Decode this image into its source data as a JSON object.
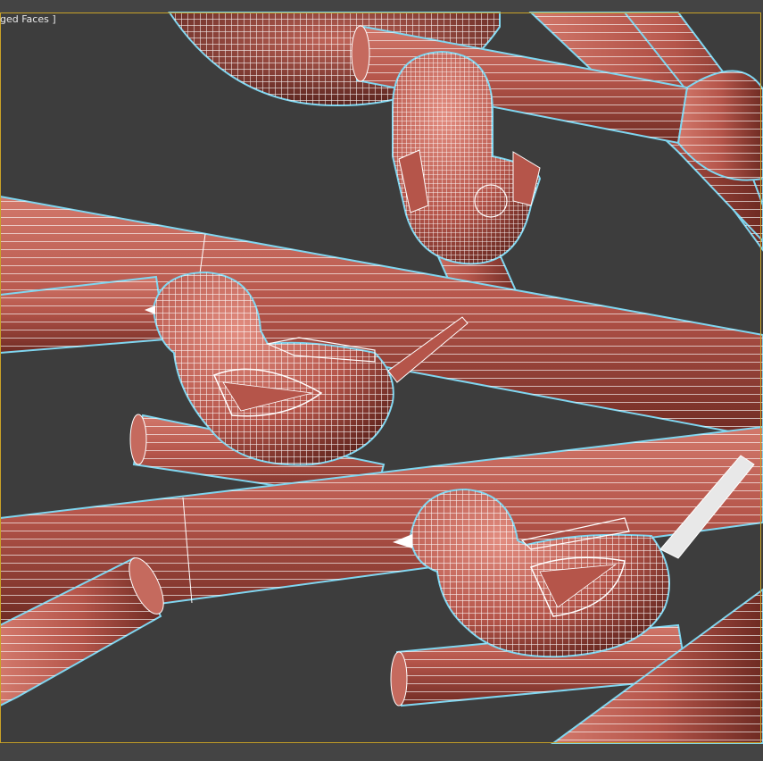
{
  "viewport": {
    "label": "ged Faces ]"
  },
  "colors": {
    "background": "#3d3d3d",
    "branch": "#b5554a",
    "wire": "#ffffff",
    "selection_outline": "#7fd6f0",
    "viewport_border": "#c9a227"
  },
  "scene": {
    "objects": [
      "branch",
      "branch",
      "branch",
      "branch",
      "branch",
      "bird",
      "bird",
      "bird",
      "nest"
    ]
  }
}
